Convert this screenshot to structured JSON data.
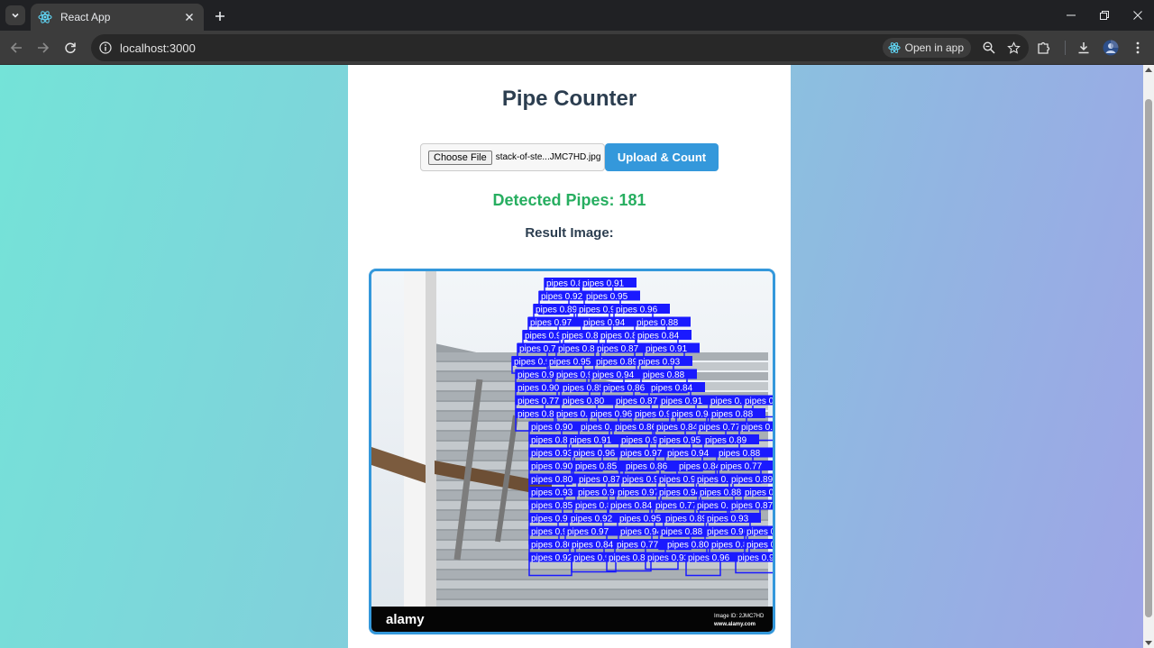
{
  "browser": {
    "tab_title": "React App",
    "url": "localhost:3000",
    "open_in_app": "Open in app"
  },
  "app": {
    "title": "Pipe Counter",
    "choose_file_label": "Choose File",
    "file_name": "stack-of-ste...JMC7HD.jpg",
    "upload_label": "Upload & Count",
    "detected_text": "Detected Pipes: 181",
    "result_label": "Result Image:"
  },
  "result_image": {
    "detection_label": "pipes",
    "watermark_logo": "alamy",
    "image_id": "Image ID: 2JMC7HD",
    "site": "www.alamy.com",
    "sample_scores": [
      "0.87",
      "0.91",
      "0.92",
      "0.95",
      "0.89",
      "0.93",
      "0.96",
      "0.97",
      "0.94",
      "0.88",
      "0.90",
      "0.85",
      "0.86",
      "0.84",
      "0.77",
      "0.80"
    ]
  },
  "colors": {
    "accent": "#3498db",
    "success": "#27ae60",
    "heading": "#2c3e50",
    "detection_box": "#1a1aff"
  }
}
